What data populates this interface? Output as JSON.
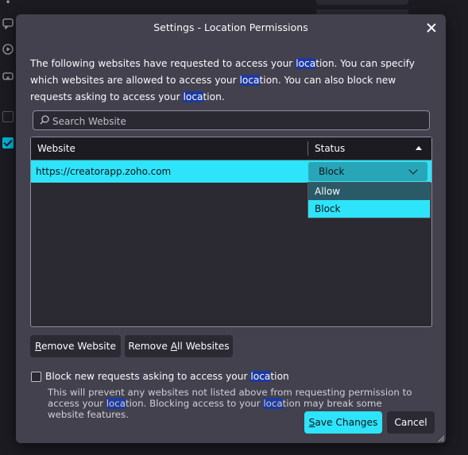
{
  "dialog": {
    "title": "Settings - Location Permissions",
    "description": {
      "p1": "The following websites have requested to access your ",
      "hl1": "loca",
      "p2": "tion. You can specify which websites are allowed to access your ",
      "hl2": "loca",
      "p3": "tion. You can also block new requests asking to access your ",
      "hl3": "loca",
      "p4": "tion."
    },
    "search_placeholder": "Search Website",
    "table": {
      "col_website": "Website",
      "col_status": "Status",
      "rows": [
        {
          "website": "https://creatorapp.zoho.com",
          "status": "Block"
        }
      ],
      "status_options": [
        "Allow",
        "Block"
      ]
    },
    "remove_button": {
      "u": "R",
      "rest": "emove Website"
    },
    "remove_all_button": {
      "pre": "Remove ",
      "u": "A",
      "rest": "ll Websites"
    },
    "block_checkbox": {
      "p1": "Block new requests asking to access your ",
      "hl": "loca",
      "p2": "tion"
    },
    "block_note": {
      "p1": "This will prevent any websites not listed above from requesting permission to access your ",
      "hl1": "loca",
      "p2": "tion. Blocking access to your ",
      "hl2": "loca",
      "p3": "tion may break some website features."
    },
    "save_button": {
      "u": "S",
      "rest": "ave Changes"
    },
    "cancel_button": "Cancel"
  },
  "colors": {
    "accent": "#2ee4fa",
    "dialog_bg": "#42414d",
    "highlight": "#1d3a9e"
  }
}
